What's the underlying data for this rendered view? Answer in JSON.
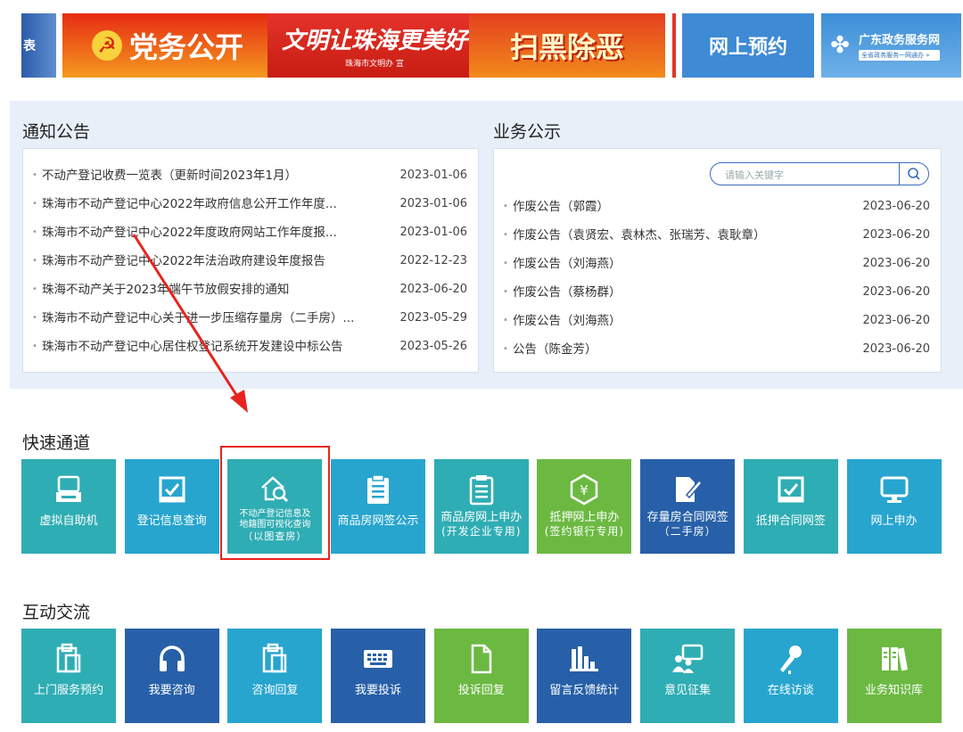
{
  "banners": {
    "edge_label": "表",
    "party_label": "党务公开",
    "civil_main": "文明让珠海更美好",
    "civil_sub": "珠海市文明办 宣",
    "anti_label": "扫黑除恶",
    "appointment_label": "网上预约",
    "gd_title": "广东政务服务网",
    "gd_sub": "全省政务服务一网通办 »"
  },
  "notices": {
    "title": "通知公告",
    "items": [
      {
        "text": "不动产登记收费一览表（更新时间2023年1月）",
        "date": "2023-01-06"
      },
      {
        "text": "珠海市不动产登记中心2022年政府信息公开工作年度...",
        "date": "2023-01-06"
      },
      {
        "text": "珠海市不动产登记中心2022年度政府网站工作年度报...",
        "date": "2023-01-06"
      },
      {
        "text": "珠海市不动产登记中心2022年法治政府建设年度报告",
        "date": "2022-12-23"
      },
      {
        "text": "珠海不动产关于2023年端午节放假安排的通知",
        "date": "2023-06-20"
      },
      {
        "text": "珠海市不动产登记中心关于进一步压缩存量房（二手房）...",
        "date": "2023-05-29"
      },
      {
        "text": "珠海市不动产登记中心居住权登记系统开发建设中标公告",
        "date": "2023-05-26"
      }
    ]
  },
  "business": {
    "title": "业务公示",
    "search_placeholder": "请输入关键字",
    "items": [
      {
        "text": "作废公告（郭霞）",
        "date": "2023-06-20"
      },
      {
        "text": "作废公告（袁贤宏、袁林杰、张瑞芳、袁耿章）",
        "date": "2023-06-20"
      },
      {
        "text": "作废公告（刘海燕）",
        "date": "2023-06-20"
      },
      {
        "text": "作废公告（蔡杨群）",
        "date": "2023-06-20"
      },
      {
        "text": "作废公告（刘海燕）",
        "date": "2023-06-20"
      },
      {
        "text": "公告（陈金芳）",
        "date": "2023-06-20"
      }
    ]
  },
  "quick": {
    "title": "快速通道",
    "tiles": [
      {
        "label": "虚拟自助机",
        "sub": "",
        "icon": "terminal-icon",
        "color": "#2fadb4"
      },
      {
        "label": "登记信息查询",
        "sub": "",
        "icon": "checkbox-icon",
        "color": "#27a5cf"
      },
      {
        "label": "不动产登记信息及",
        "label2": "地籍图可视化查询",
        "sub": "（以图查房）",
        "icon": "house-search-icon",
        "color": "#2fadb4"
      },
      {
        "label": "商品房网签公示",
        "sub": "",
        "icon": "clipboard-icon",
        "color": "#27a5cf"
      },
      {
        "label": "商品房网上申办",
        "sub": "(开发企业专用)",
        "icon": "clipboard-list-icon",
        "color": "#2fadb4"
      },
      {
        "label": "抵押网上申办",
        "sub": "(签约银行专用)",
        "icon": "yuan-shield-icon",
        "color": "#6cb942"
      },
      {
        "label": "存量房合同网签",
        "sub": "（二手房）",
        "icon": "sign-pen-icon",
        "color": "#2760a8"
      },
      {
        "label": "抵押合同网签",
        "sub": "",
        "icon": "checkbox-icon",
        "color": "#2fadb4"
      },
      {
        "label": "网上申办",
        "sub": "",
        "icon": "monitor-icon",
        "color": "#27a5cf"
      }
    ]
  },
  "interact": {
    "title": "互动交流",
    "tiles": [
      {
        "label": "上门服务预约",
        "icon": "clipboard-doc-icon",
        "color": "#2fadb4"
      },
      {
        "label": "我要咨询",
        "icon": "headphones-icon",
        "color": "#2760a8"
      },
      {
        "label": "咨询回复",
        "icon": "clipboard-doc-icon",
        "color": "#27a5cf"
      },
      {
        "label": "我要投诉",
        "icon": "keyboard-icon",
        "color": "#2760a8"
      },
      {
        "label": "投诉回复",
        "icon": "document-icon",
        "color": "#6cb942"
      },
      {
        "label": "留言反馈统计",
        "icon": "bar-chart-icon",
        "color": "#2760a8"
      },
      {
        "label": "意见征集",
        "icon": "presentation-icon",
        "color": "#2fadb4"
      },
      {
        "label": "在线访谈",
        "icon": "microphone-icon",
        "color": "#27a5cf"
      },
      {
        "label": "业务知识库",
        "icon": "books-icon",
        "color": "#6cb942"
      }
    ]
  },
  "annotation": {
    "color": "#e8231e"
  }
}
